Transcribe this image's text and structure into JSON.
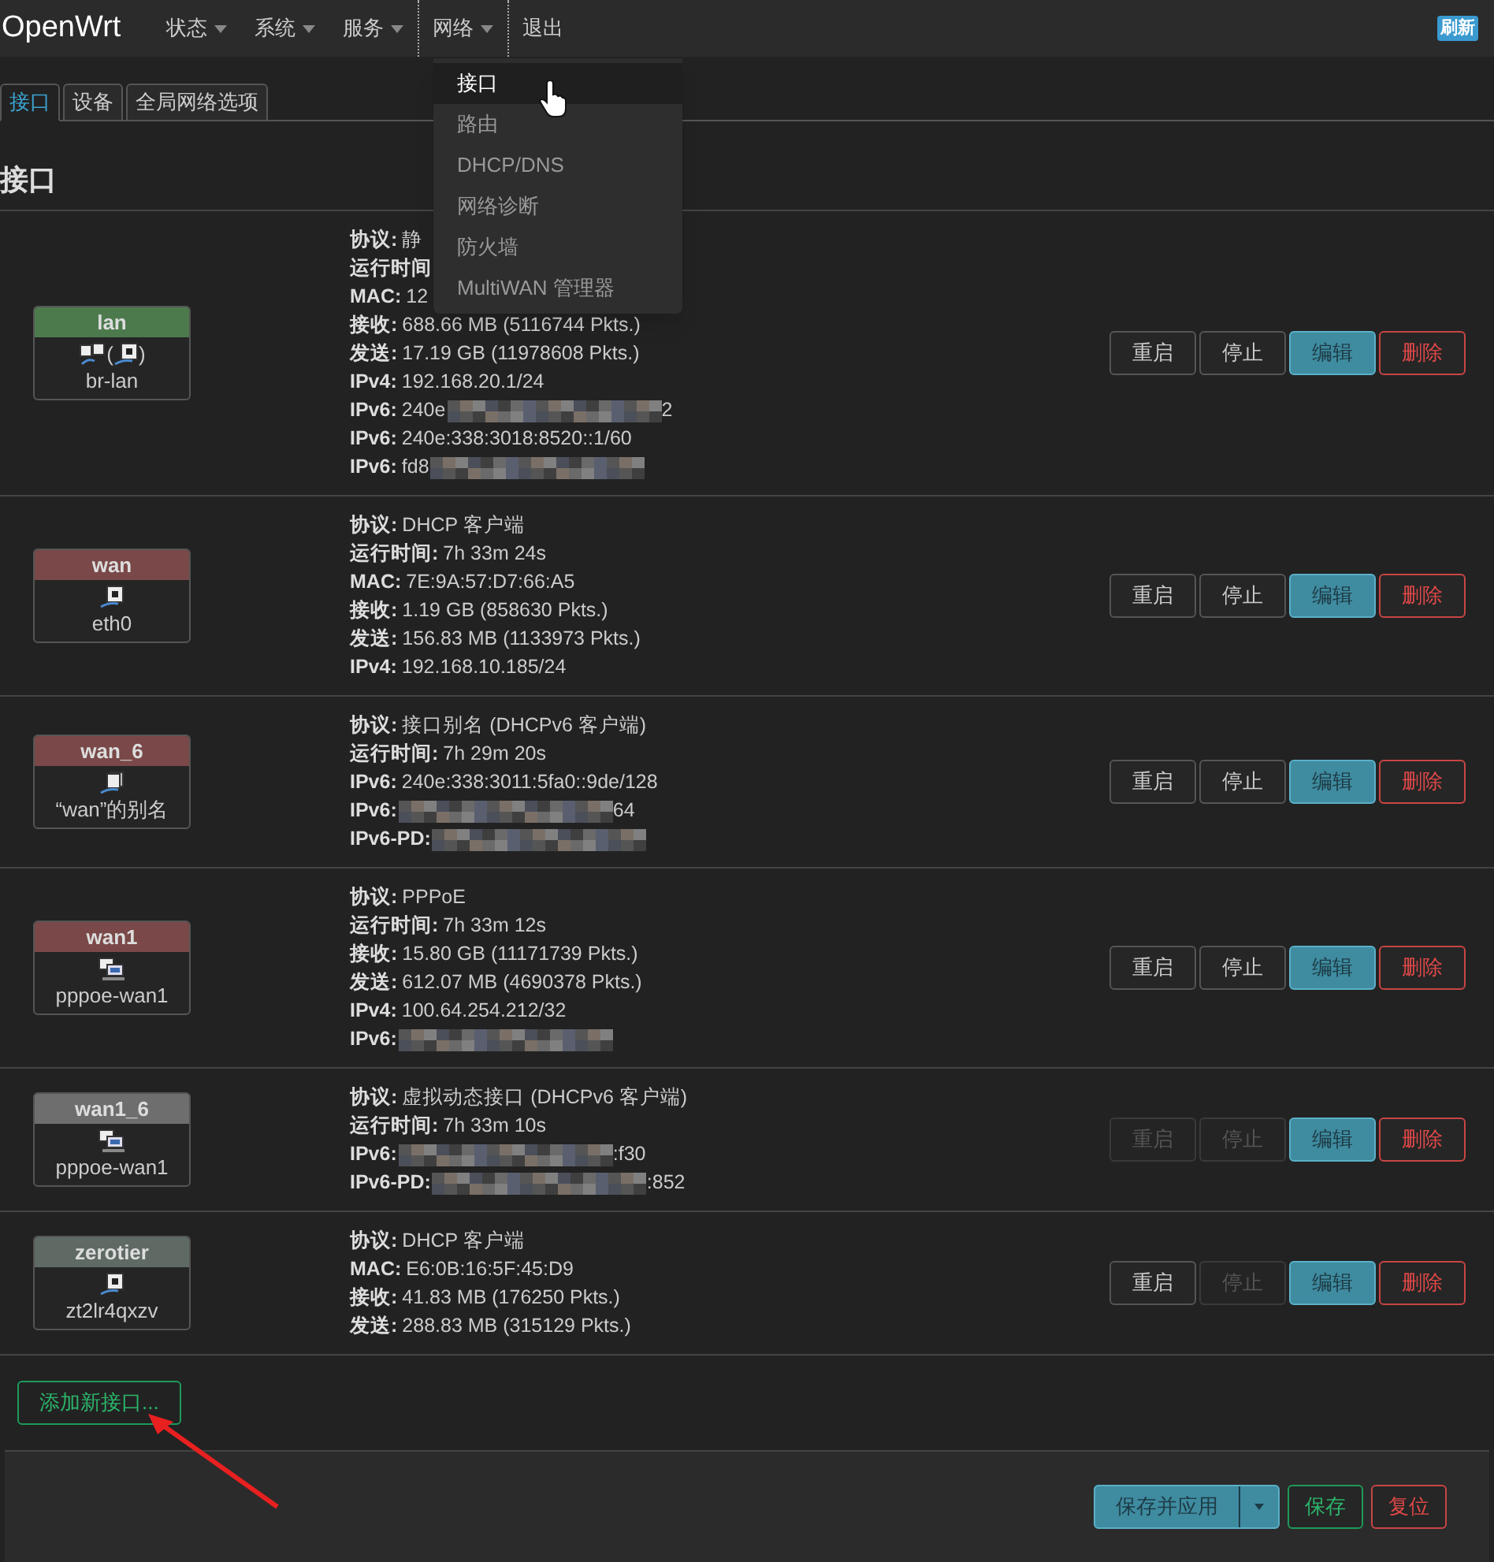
{
  "navbar": {
    "brand": "OpenWrt",
    "menus": [
      {
        "label": "状态",
        "has_menu": true,
        "selected": false
      },
      {
        "label": "系统",
        "has_menu": true,
        "selected": false
      },
      {
        "label": "服务",
        "has_menu": true,
        "selected": false
      },
      {
        "label": "网络",
        "has_menu": true,
        "selected": true
      },
      {
        "label": "退出",
        "has_menu": false,
        "selected": false
      }
    ],
    "refresh": "刷新"
  },
  "dropdown": {
    "items": [
      {
        "label": "接口",
        "selected": true
      },
      {
        "label": "路由",
        "selected": false
      },
      {
        "label": "DHCP/DNS",
        "selected": false
      },
      {
        "label": "网络诊断",
        "selected": false
      },
      {
        "label": "防火墙",
        "selected": false
      },
      {
        "label": "MultiWAN 管理器",
        "selected": false
      }
    ]
  },
  "tabs": [
    {
      "label": "接口",
      "selected": true
    },
    {
      "label": "设备",
      "selected": false
    },
    {
      "label": "全局网络选项",
      "selected": false
    }
  ],
  "heading": "接口",
  "interfaces": [
    {
      "name": "lan",
      "color": "#4d7a4d",
      "device": "br-lan",
      "icon_parts": [
        {
          "kind": "bridge"
        },
        {
          "kind": "text",
          "text": "("
        },
        {
          "kind": "port"
        },
        {
          "kind": "text",
          "text": ")"
        }
      ],
      "info": [
        {
          "label": "协议:",
          "value": "静"
        },
        {
          "label": "运行时间"
        },
        {
          "label": "MAC:",
          "value": "12"
        },
        {
          "label": "接收:",
          "value": "688.66 MB (5116744 Pkts.)"
        },
        {
          "label": "发送:",
          "value": "17.19 GB (11978608 Pkts.)"
        },
        {
          "label": "IPv4:",
          "value": "192.168.20.1/24"
        },
        {
          "label": "IPv6:",
          "value": "240e",
          "redacted": true,
          "suffix": "2"
        },
        {
          "label": "IPv6:",
          "value": "240e:338:3018:8520::1/60"
        },
        {
          "label": "IPv6:",
          "value": "fd8",
          "redacted": true
        }
      ],
      "buttons": [
        {
          "label": "重启",
          "kind": "neutral",
          "disabled": false
        },
        {
          "label": "停止",
          "kind": "neutral",
          "disabled": false
        },
        {
          "label": "编辑",
          "kind": "edit",
          "disabled": false
        },
        {
          "label": "删除",
          "kind": "delete",
          "disabled": false
        }
      ]
    },
    {
      "name": "wan",
      "color": "#7a4848",
      "device": "eth0",
      "icon_parts": [
        {
          "kind": "port"
        }
      ],
      "info": [
        {
          "label": "协议:",
          "value": "DHCP 客户端"
        },
        {
          "label": "运行时间:",
          "value": "7h 33m 24s"
        },
        {
          "label": "MAC:",
          "value": "7E:9A:57:D7:66:A5"
        },
        {
          "label": "接收:",
          "value": "1.19 GB (858630 Pkts.)"
        },
        {
          "label": "发送:",
          "value": "156.83 MB (1133973 Pkts.)"
        },
        {
          "label": "IPv4:",
          "value": "192.168.10.185/24"
        }
      ],
      "buttons": [
        {
          "label": "重启",
          "kind": "neutral",
          "disabled": false
        },
        {
          "label": "停止",
          "kind": "neutral",
          "disabled": false
        },
        {
          "label": "编辑",
          "kind": "edit",
          "disabled": false
        },
        {
          "label": "删除",
          "kind": "delete",
          "disabled": false
        }
      ]
    },
    {
      "name": "wan_6",
      "color": "#7a4848",
      "device": "“wan”的别名",
      "icon_parts": [
        {
          "kind": "alias"
        }
      ],
      "info": [
        {
          "label": "协议:",
          "value": "接口别名 (DHCPv6 客户端)"
        },
        {
          "label": "运行时间:",
          "value": "7h 29m 20s"
        },
        {
          "label": "IPv6:",
          "value": "240e:338:3011:5fa0::9de/128"
        },
        {
          "label": "IPv6:",
          "redacted": true,
          "suffix": "64"
        },
        {
          "label": "IPv6-PD:",
          "redacted": true
        }
      ],
      "buttons": [
        {
          "label": "重启",
          "kind": "neutral",
          "disabled": false
        },
        {
          "label": "停止",
          "kind": "neutral",
          "disabled": false
        },
        {
          "label": "编辑",
          "kind": "edit",
          "disabled": false
        },
        {
          "label": "删除",
          "kind": "delete",
          "disabled": false
        }
      ]
    },
    {
      "name": "wan1",
      "color": "#7a4848",
      "device": "pppoe-wan1",
      "icon_parts": [
        {
          "kind": "tunnel"
        }
      ],
      "info": [
        {
          "label": "协议:",
          "value": "PPPoE"
        },
        {
          "label": "运行时间:",
          "value": "7h 33m 12s"
        },
        {
          "label": "接收:",
          "value": "15.80 GB (11171739 Pkts.)"
        },
        {
          "label": "发送:",
          "value": "612.07 MB (4690378 Pkts.)"
        },
        {
          "label": "IPv4:",
          "value": "100.64.254.212/32"
        },
        {
          "label": "IPv6:",
          "redacted": true
        }
      ],
      "buttons": [
        {
          "label": "重启",
          "kind": "neutral",
          "disabled": false
        },
        {
          "label": "停止",
          "kind": "neutral",
          "disabled": false
        },
        {
          "label": "编辑",
          "kind": "edit",
          "disabled": false
        },
        {
          "label": "删除",
          "kind": "delete",
          "disabled": false
        }
      ]
    },
    {
      "name": "wan1_6",
      "color": "#6e6e6e",
      "device": "pppoe-wan1",
      "icon_parts": [
        {
          "kind": "tunnel"
        }
      ],
      "info": [
        {
          "label": "协议:",
          "value": "虚拟动态接口 (DHCPv6 客户端)"
        },
        {
          "label": "运行时间:",
          "value": "7h 33m 10s"
        },
        {
          "label": "IPv6:",
          "redacted": true,
          "suffix": ":f30"
        },
        {
          "label": "IPv6-PD:",
          "redacted": true,
          "suffix": ":852"
        }
      ],
      "buttons": [
        {
          "label": "重启",
          "kind": "neutral",
          "disabled": true
        },
        {
          "label": "停止",
          "kind": "neutral",
          "disabled": true
        },
        {
          "label": "编辑",
          "kind": "edit",
          "disabled": false
        },
        {
          "label": "删除",
          "kind": "delete",
          "disabled": false
        }
      ]
    },
    {
      "name": "zerotier",
      "color": "#5f6a64",
      "device": "zt2lr4qxzv",
      "icon_parts": [
        {
          "kind": "port"
        }
      ],
      "info": [
        {
          "label": "协议:",
          "value": "DHCP 客户端"
        },
        {
          "label": "MAC:",
          "value": "E6:0B:16:5F:45:D9"
        },
        {
          "label": "接收:",
          "value": "41.83 MB (176250 Pkts.)"
        },
        {
          "label": "发送:",
          "value": "288.83 MB (315129 Pkts.)"
        }
      ],
      "buttons": [
        {
          "label": "重启",
          "kind": "neutral",
          "disabled": false
        },
        {
          "label": "停止",
          "kind": "neutral",
          "disabled": true
        },
        {
          "label": "编辑",
          "kind": "edit",
          "disabled": false
        },
        {
          "label": "删除",
          "kind": "delete",
          "disabled": false
        }
      ]
    }
  ],
  "add_button": "添加新接口...",
  "footer": {
    "save_apply": "保存并应用",
    "save": "保存",
    "reset": "复位"
  }
}
